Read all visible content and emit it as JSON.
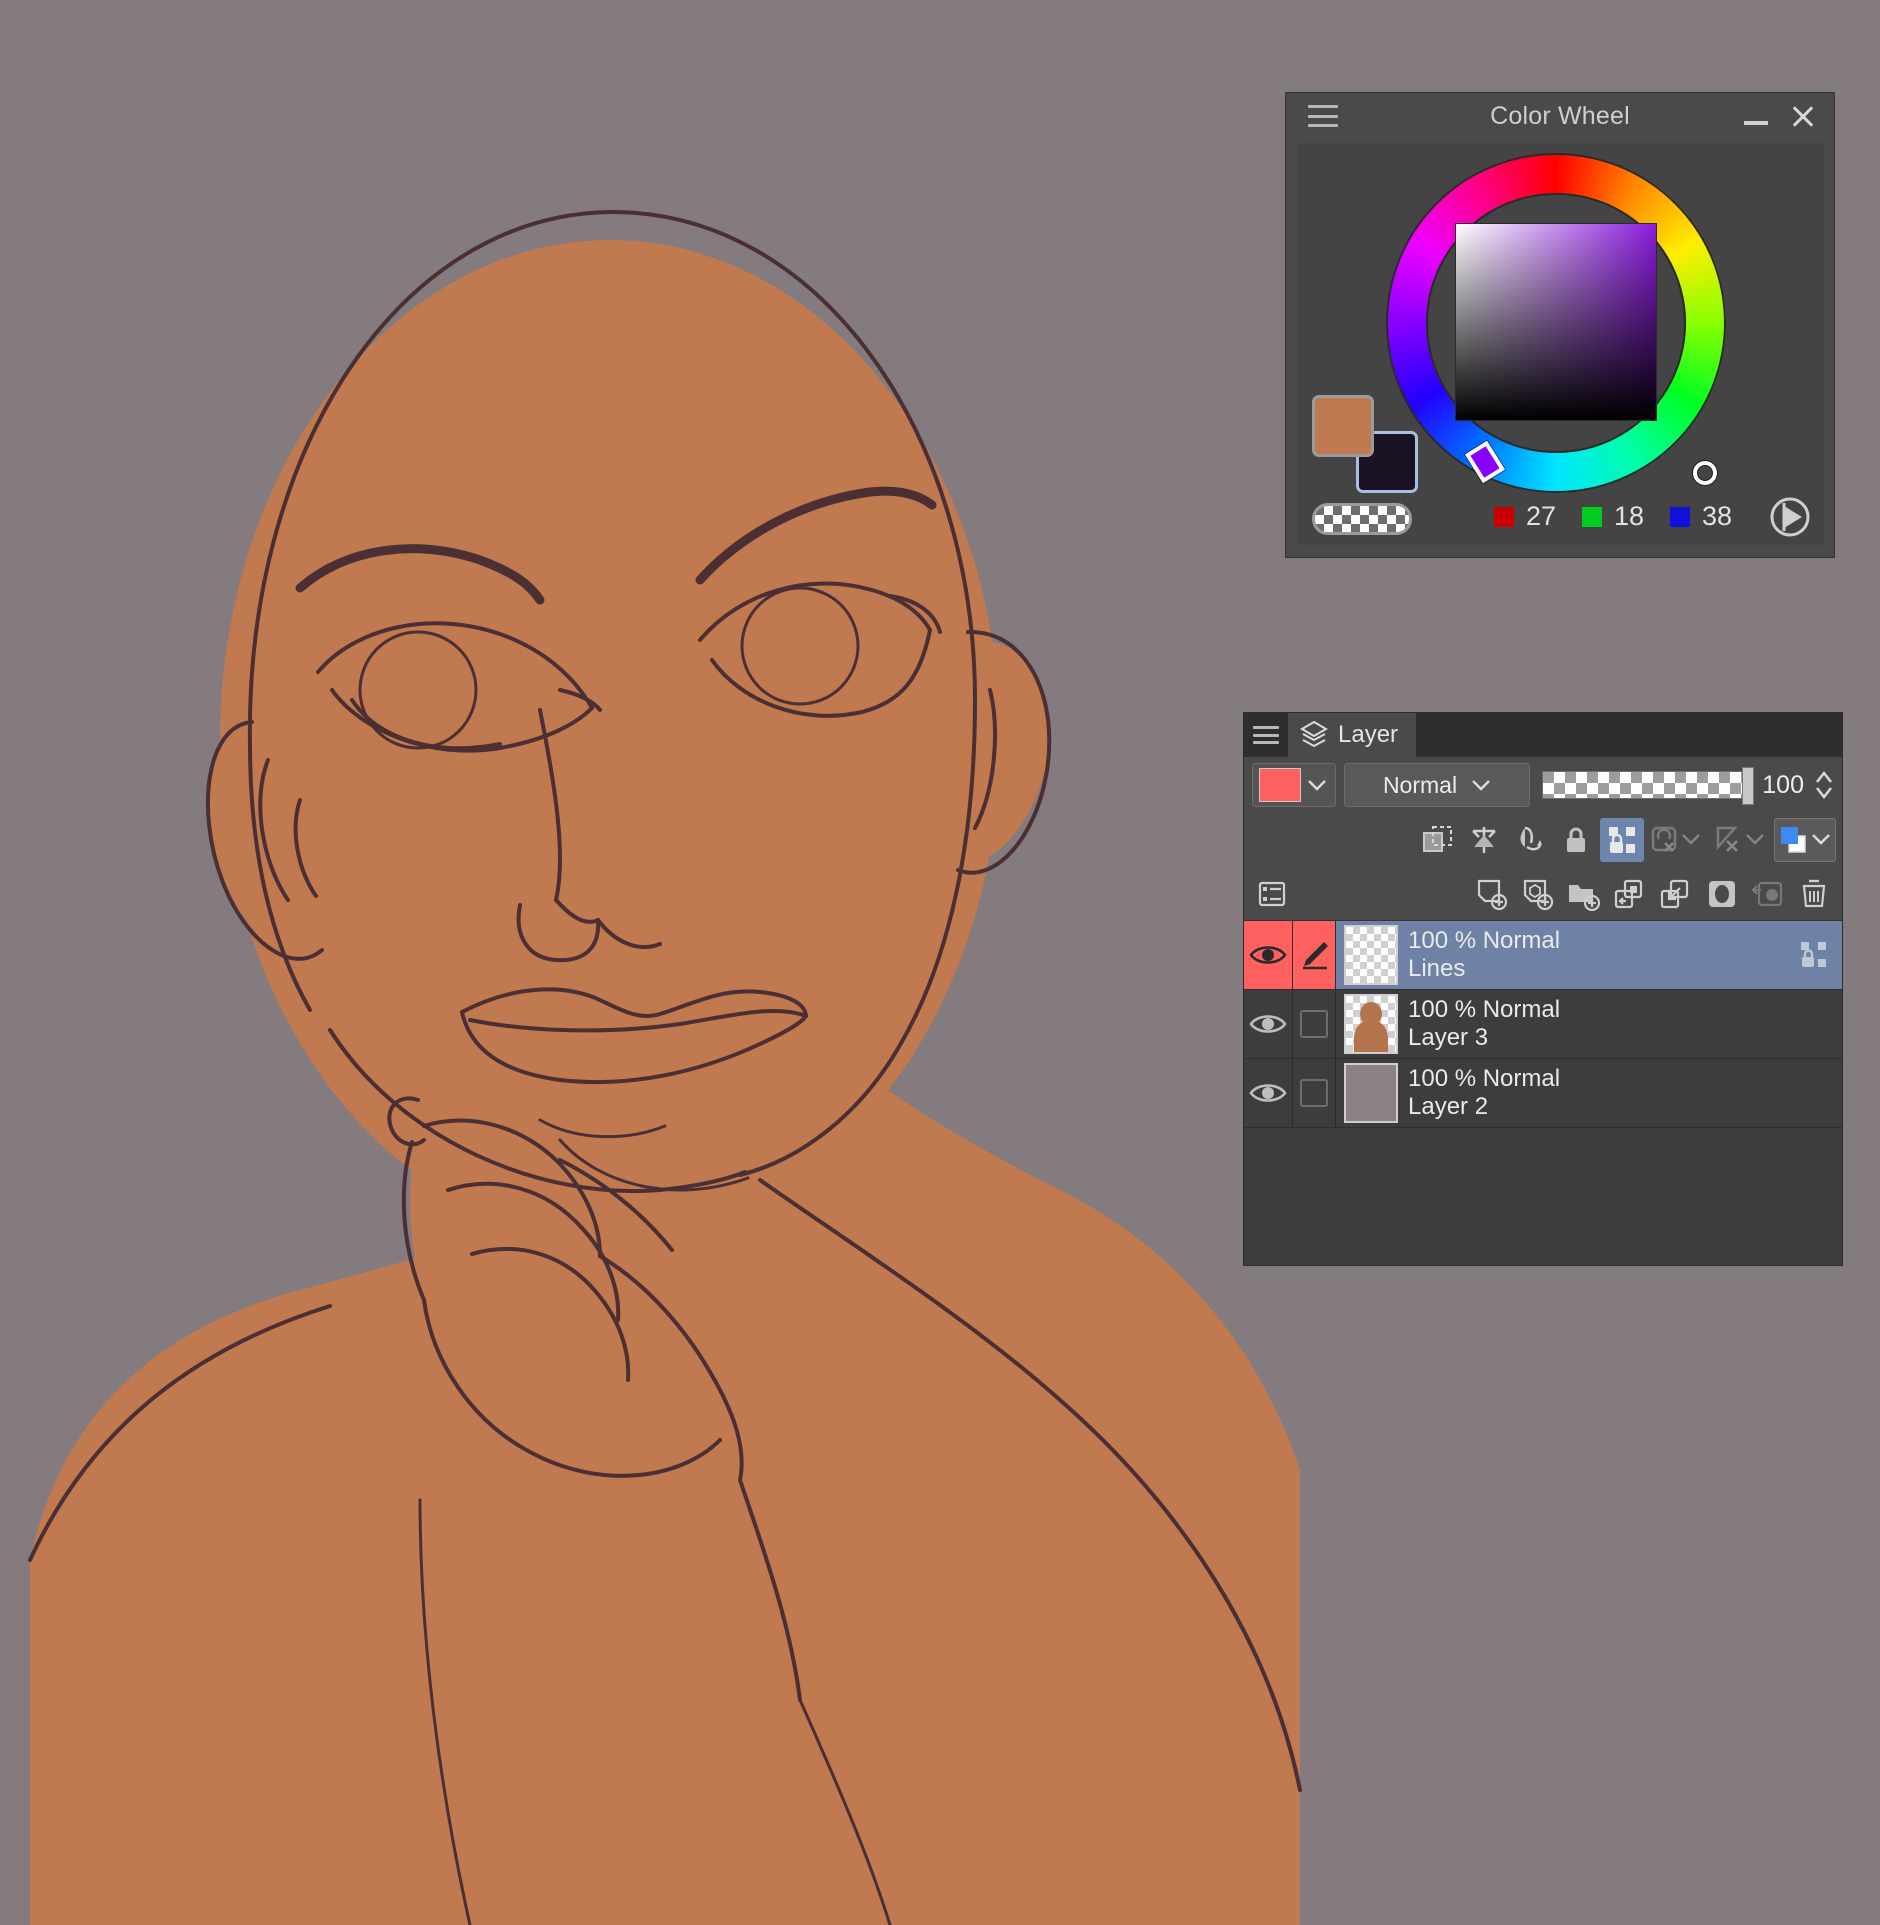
{
  "canvas": {
    "background_color": "#837b7d",
    "artwork_description": "Line-art portrait of a bald figure resting chin on hand",
    "skin_fill": "#c1794f",
    "line_color": "#3a2a2e"
  },
  "color_wheel_panel": {
    "title": "Color Wheel",
    "menu_icon": "hamburger-icon",
    "minimize_icon": "minimize-icon",
    "close_icon": "close-icon",
    "foreground_color": "#c17a4f",
    "background_color": "#1b1226",
    "transparent_label": "transparent-swatch",
    "sv_selected_color": "#1b1226",
    "hue_marker_color": "#8a00ff",
    "rgb": [
      {
        "channel": "R",
        "chip_color": "#cc0000",
        "value": "27"
      },
      {
        "channel": "G",
        "chip_color": "#00cc22",
        "value": "18"
      },
      {
        "channel": "B",
        "chip_color": "#1111dd",
        "value": "38"
      }
    ],
    "extra_icon": "circle-play-icon"
  },
  "layer_panel": {
    "menu_icon": "hamburger-icon",
    "tab": {
      "icon": "layers-stack-icon",
      "label": "Layer"
    },
    "color_swatch": "#ff6161",
    "color_dropdown_icon": "chevron-down-icon",
    "blend_mode": "Normal",
    "blend_dropdown_icon": "chevron-down-icon",
    "opacity_value": "100",
    "opacity_spinner_icon": "spinner-up-down-icon",
    "toolbar_row1": [
      {
        "name": "clip-to-layer-below-icon",
        "state": "normal"
      },
      {
        "name": "lock-transparent-pixels-icon",
        "state": "normal"
      },
      {
        "name": "lock-alpha-icon",
        "state": "normal"
      },
      {
        "name": "lock-layer-icon",
        "state": "normal"
      },
      {
        "name": "lock-transparency-grid-icon",
        "state": "active"
      },
      {
        "name": "ruler-snap-icon",
        "state": "dim"
      },
      {
        "name": "perspective-snap-icon",
        "state": "dim"
      },
      {
        "name": "layer-color-icon",
        "state": "normal"
      }
    ],
    "toolbar_row2": [
      {
        "name": "layer-list-icon",
        "state": "normal"
      },
      {
        "name": "new-raster-layer-icon",
        "state": "normal"
      },
      {
        "name": "new-3d-layer-icon",
        "state": "normal"
      },
      {
        "name": "new-folder-icon",
        "state": "normal"
      },
      {
        "name": "transfer-down-icon",
        "state": "normal"
      },
      {
        "name": "merge-down-icon",
        "state": "normal"
      },
      {
        "name": "layer-mask-icon",
        "state": "normal"
      },
      {
        "name": "duplicate-layer-icon",
        "state": "dim"
      },
      {
        "name": "delete-layer-icon",
        "state": "normal"
      }
    ],
    "layers": [
      {
        "opacity_blend": "100 % Normal",
        "name": "Lines",
        "selected": true,
        "visible": true,
        "eye_icon": "eye-open-icon",
        "pen_icon": "pen-edit-icon",
        "pen_active": true,
        "lock_icon": "lock-transparency-grid-icon",
        "thumbnail": "transparent"
      },
      {
        "opacity_blend": "100 % Normal",
        "name": "Layer 3",
        "selected": false,
        "visible": true,
        "eye_icon": "eye-open-icon",
        "pen_icon": "checkbox-empty-icon",
        "pen_active": false,
        "lock_icon": "",
        "thumbnail": "figure"
      },
      {
        "opacity_blend": "100 % Normal",
        "name": "Layer 2",
        "selected": false,
        "visible": true,
        "eye_icon": "eye-open-icon",
        "pen_icon": "checkbox-empty-icon",
        "pen_active": false,
        "lock_icon": "",
        "thumbnail": "gray"
      }
    ]
  }
}
